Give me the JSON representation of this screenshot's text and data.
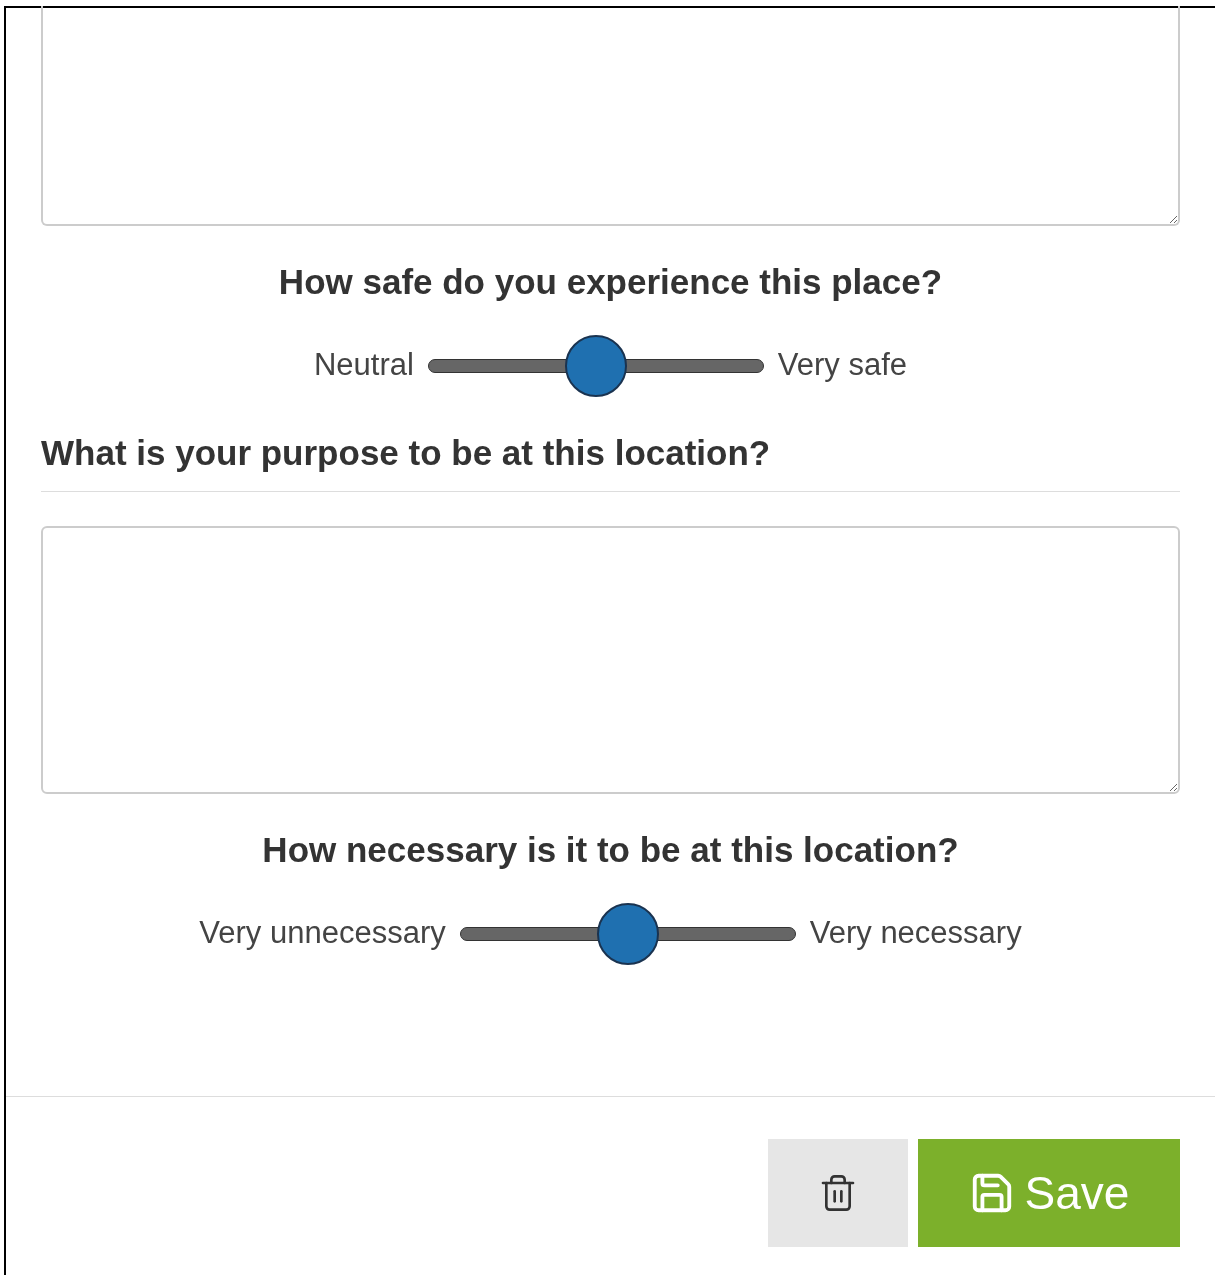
{
  "sections": [
    {
      "kind": "textarea",
      "cut_top": true
    },
    {
      "kind": "slider",
      "title": "How safe do you experience this place?",
      "min_label": "Neutral",
      "max_label": "Very safe",
      "level": 0.5
    },
    {
      "kind": "question",
      "title": "What is your purpose to be at this location?"
    },
    {
      "kind": "textarea",
      "cut_top": false
    },
    {
      "kind": "slider",
      "title": "How necessary is it to be at this location?",
      "min_label": "Very unnecessary",
      "max_label": "Very necessary",
      "level": 0.5
    }
  ],
  "footer": {
    "save_label": "Save"
  }
}
